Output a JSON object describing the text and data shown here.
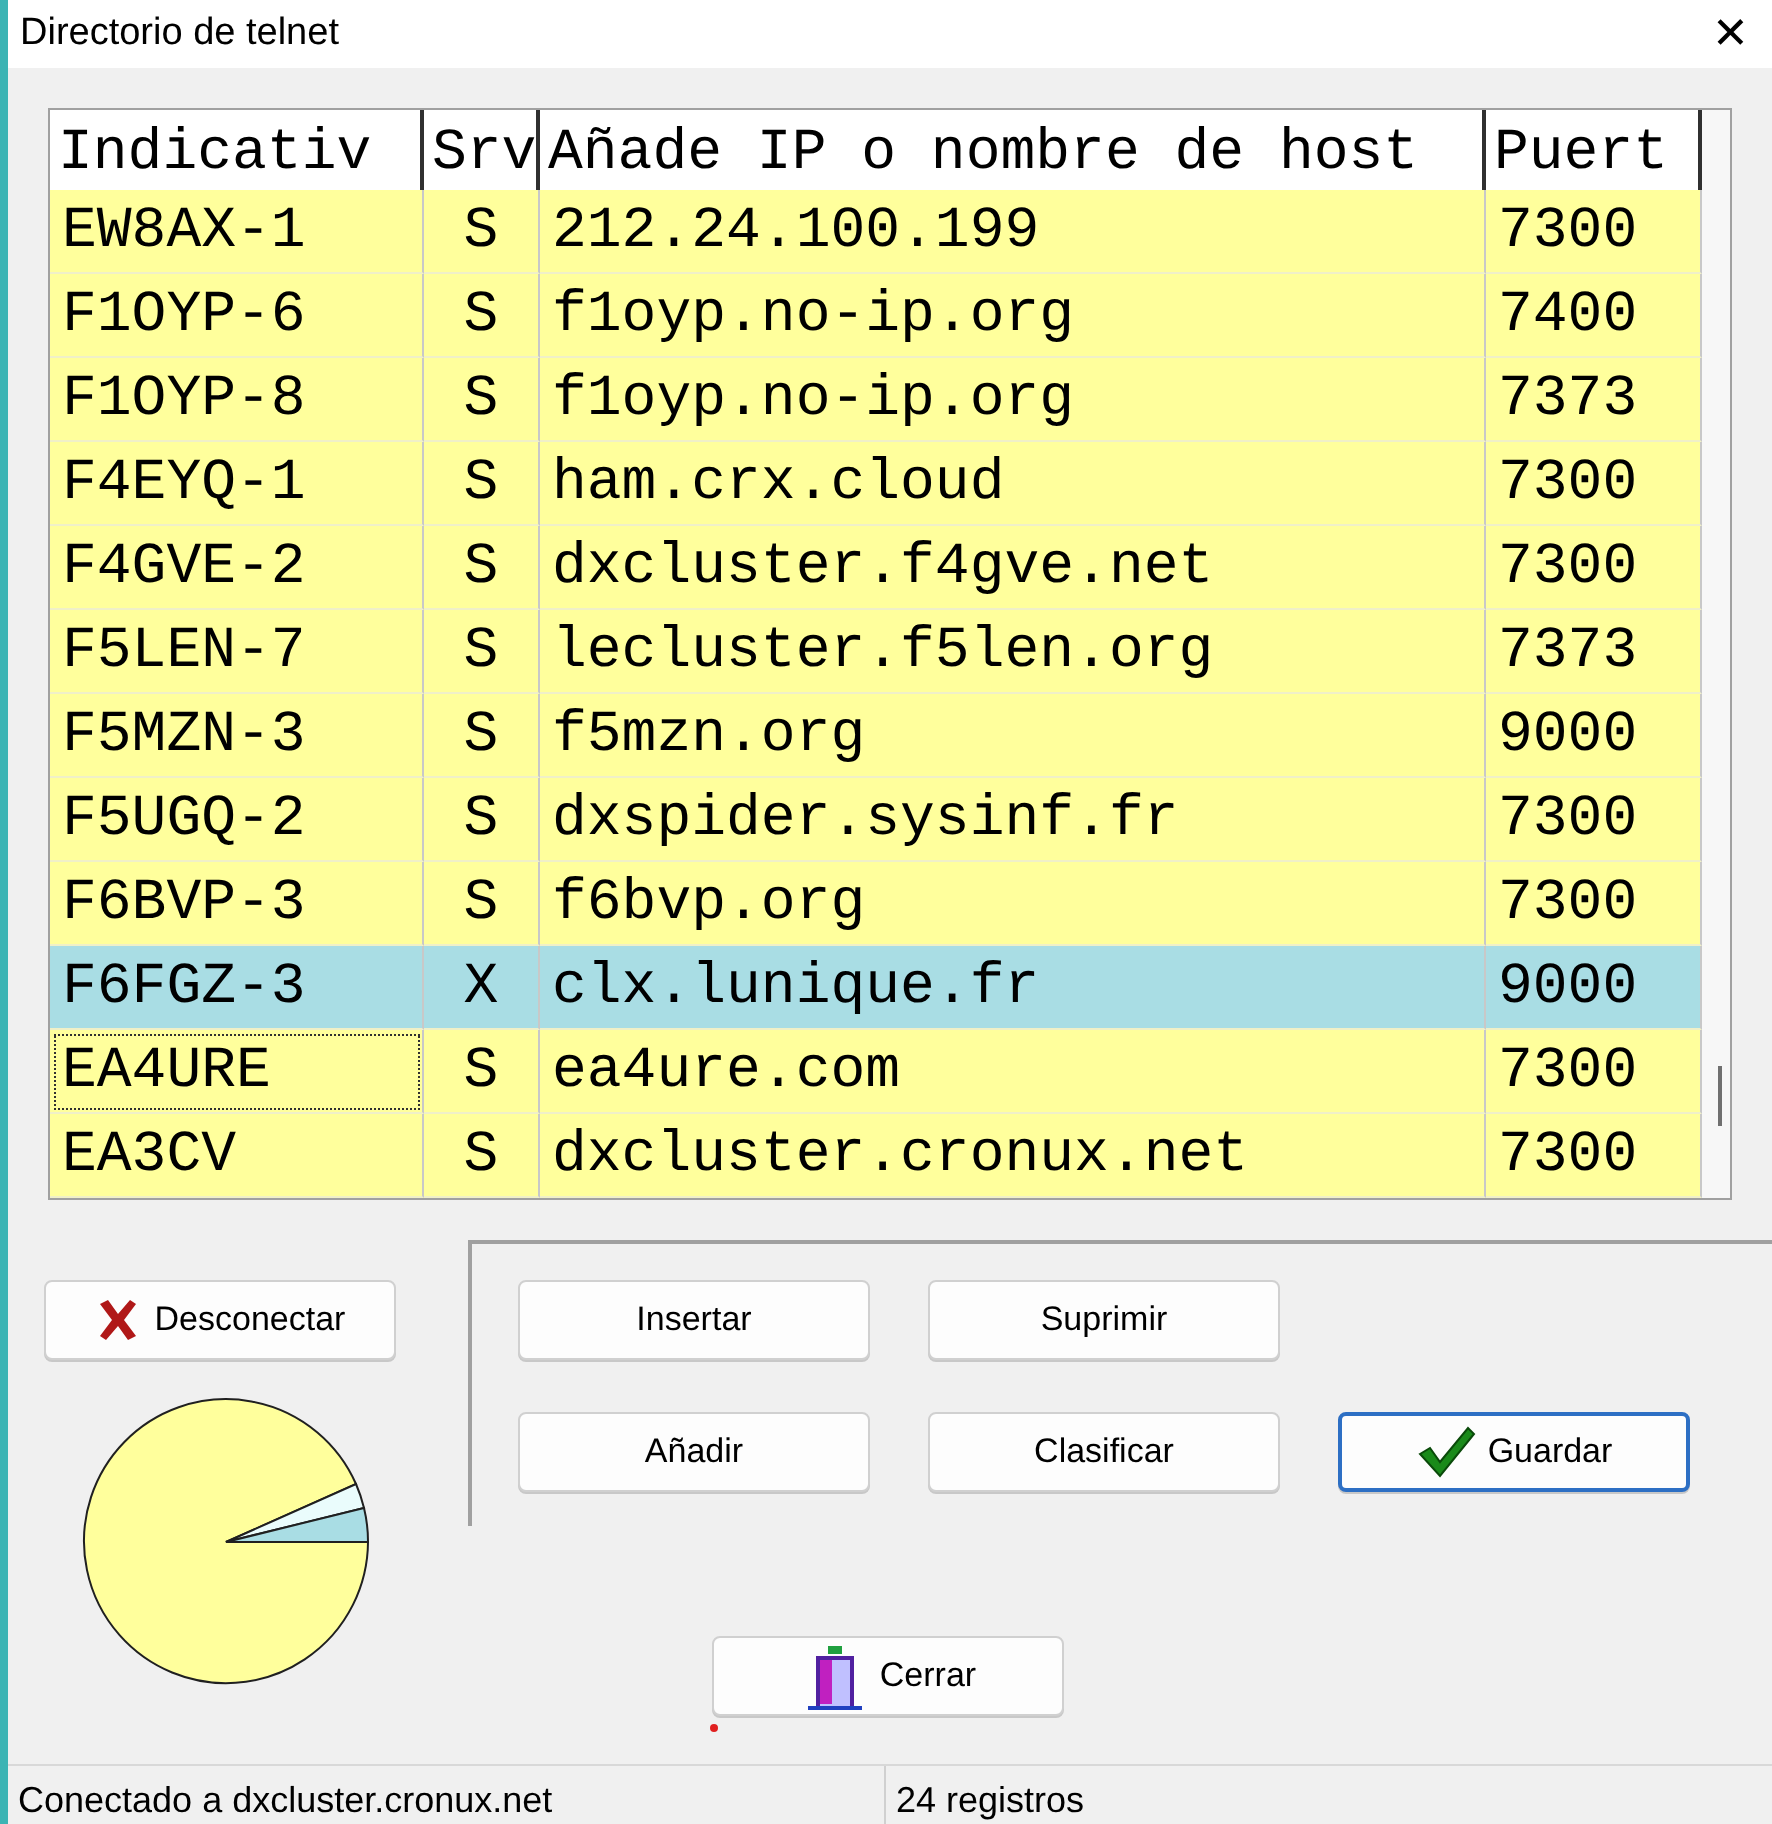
{
  "window": {
    "title": "Directorio de telnet",
    "close": "✕"
  },
  "table": {
    "columns": [
      "Indicativ",
      "Srv",
      "Añade IP o nombre de host",
      "Puert"
    ],
    "rows": [
      {
        "cells": [
          "EW8AX-1",
          "S",
          "212.24.100.199",
          "7300"
        ],
        "selected": false,
        "focused": false
      },
      {
        "cells": [
          "F1OYP-6",
          "S",
          "f1oyp.no-ip.org",
          "7400"
        ],
        "selected": false,
        "focused": false
      },
      {
        "cells": [
          "F1OYP-8",
          "S",
          "f1oyp.no-ip.org",
          "7373"
        ],
        "selected": false,
        "focused": false
      },
      {
        "cells": [
          "F4EYQ-1",
          "S",
          "ham.crx.cloud",
          "7300"
        ],
        "selected": false,
        "focused": false
      },
      {
        "cells": [
          "F4GVE-2",
          "S",
          "dxcluster.f4gve.net",
          "7300"
        ],
        "selected": false,
        "focused": false
      },
      {
        "cells": [
          "F5LEN-7",
          "S",
          "lecluster.f5len.org",
          "7373"
        ],
        "selected": false,
        "focused": false
      },
      {
        "cells": [
          "F5MZN-3",
          "S",
          "f5mzn.org",
          "9000"
        ],
        "selected": false,
        "focused": false
      },
      {
        "cells": [
          "F5UGQ-2",
          "S",
          "dxspider.sysinf.fr",
          "7300"
        ],
        "selected": false,
        "focused": false
      },
      {
        "cells": [
          "F6BVP-3",
          "S",
          "f6bvp.org",
          "7300"
        ],
        "selected": false,
        "focused": false
      },
      {
        "cells": [
          "F6FGZ-3",
          "X",
          "clx.lunique.fr",
          "9000"
        ],
        "selected": true,
        "focused": false
      },
      {
        "cells": [
          "EA4URE",
          "S",
          "ea4ure.com",
          "7300"
        ],
        "selected": false,
        "focused": true
      },
      {
        "cells": [
          "EA3CV",
          "S",
          "dxcluster.cronux.net",
          "7300"
        ],
        "selected": false,
        "focused": false
      }
    ]
  },
  "disconnect_button": {
    "label": "Desconectar"
  },
  "buttons": [
    {
      "label": "Insertar",
      "default": false
    },
    {
      "label": "Suprimir",
      "default": false
    },
    {
      "label": "Añadir",
      "default": false
    },
    {
      "label": "Clasificar",
      "default": false
    },
    {
      "label": "Guardar",
      "default": true
    }
  ],
  "close_button": {
    "label": "Cerrar"
  },
  "status_bar": [
    "Conectado a dxcluster.cronux.net",
    "24 registros"
  ]
}
